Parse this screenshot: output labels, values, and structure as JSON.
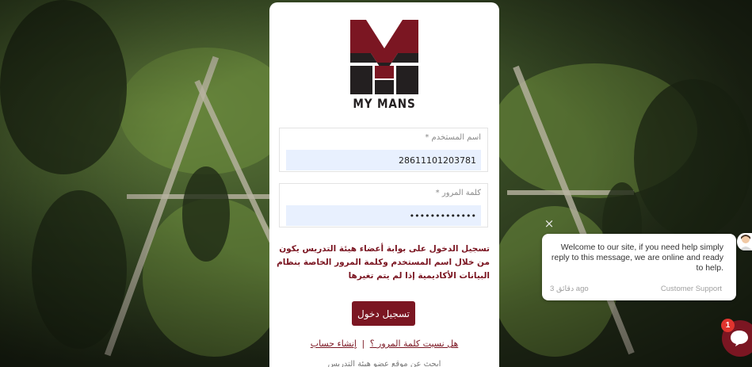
{
  "brand": {
    "logo_text": "MY MANS",
    "accent_color": "#7b1622"
  },
  "login_form": {
    "username": {
      "label": "اسم المستخدم *",
      "value": "28611101203781"
    },
    "password": {
      "label": "كلمة المرور *",
      "value": "•••••••••••••"
    },
    "notice": "تسجيل الدخول على بوابة أعضاء هيئة التدريس يكون من خلال اسم المستخدم وكلمة المرور الخاصة بنظام البيانات الأكاديمية إذا لم يتم تغيرها",
    "login_button": "تسجيل دخول",
    "forgot_password_link": "هل نسيت كلمة المرور ؟",
    "separator": "|",
    "create_account_link": "إنشاء حساب",
    "more_text": "ابحث عن موقع عضو هيئة التدريس"
  },
  "chat": {
    "close_glyph": "×",
    "message": "Welcome to our site, if you need help simply reply to this message, we are online and ready to help.",
    "time": "3 دقائق ago",
    "agent": "Customer Support",
    "badge_count": "1",
    "icons": {
      "close": "close-icon",
      "avatar": "support-avatar-icon",
      "launcher": "chat-bubble-icon"
    }
  }
}
